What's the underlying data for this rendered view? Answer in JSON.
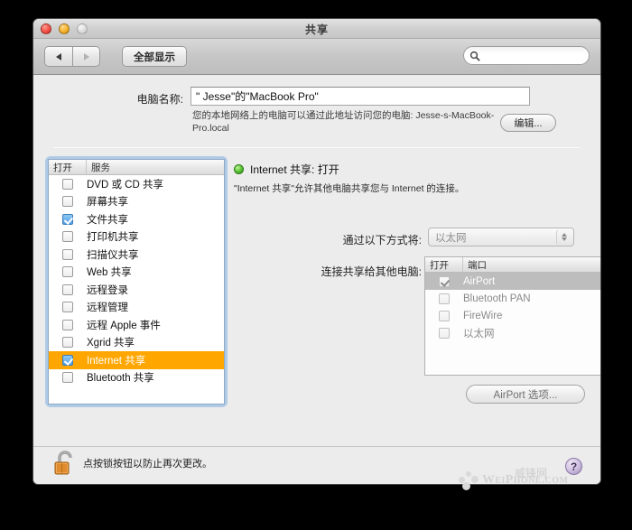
{
  "window": {
    "title": "共享",
    "traffic_lights": {
      "close": "close-button",
      "minimize": "minimize-button",
      "zoom": "zoom-button"
    }
  },
  "toolbar": {
    "back_label": "back",
    "forward_label": "forward",
    "show_all_label": "全部显示",
    "search": {
      "value": "",
      "placeholder": ""
    }
  },
  "computer_name": {
    "label": "电脑名称:",
    "value": "\" Jesse\"的\"MacBook Pro\"",
    "help_text": "您的本地网络上的电脑可以通过此地址访问您的电脑: Jesse-s-MacBook-Pro.local",
    "edit_button": "编辑..."
  },
  "service_list": {
    "columns": [
      "打开",
      "服务"
    ],
    "items": [
      {
        "label": "DVD 或 CD 共享",
        "checked": false,
        "selected": false
      },
      {
        "label": "屏幕共享",
        "checked": false,
        "selected": false
      },
      {
        "label": "文件共享",
        "checked": true,
        "selected": false
      },
      {
        "label": "打印机共享",
        "checked": false,
        "selected": false
      },
      {
        "label": "扫描仪共享",
        "checked": false,
        "selected": false
      },
      {
        "label": "Web 共享",
        "checked": false,
        "selected": false
      },
      {
        "label": "远程登录",
        "checked": false,
        "selected": false
      },
      {
        "label": "远程管理",
        "checked": false,
        "selected": false
      },
      {
        "label": "远程 Apple 事件",
        "checked": false,
        "selected": false
      },
      {
        "label": "Xgrid 共享",
        "checked": false,
        "selected": false
      },
      {
        "label": "Internet 共享",
        "checked": true,
        "selected": true
      },
      {
        "label": "Bluetooth 共享",
        "checked": false,
        "selected": false
      }
    ]
  },
  "detail": {
    "status_title": "Internet 共享: 打开",
    "status_color": "#62c83c",
    "description": "\"Internet 共享\"允许其他电脑共享您与 Internet 的连接。",
    "share_via": {
      "label": "通过以下方式将:",
      "selected": "以太网",
      "disabled": true
    },
    "ports": {
      "label": "连接共享给其他电脑:",
      "columns": [
        "打开",
        "端口"
      ],
      "items": [
        {
          "label": "AirPort",
          "checked": true,
          "selected": true
        },
        {
          "label": "Bluetooth PAN",
          "checked": false,
          "selected": false
        },
        {
          "label": "FireWire",
          "checked": false,
          "selected": false
        },
        {
          "label": "以太网",
          "checked": false,
          "selected": false
        }
      ]
    },
    "options_button": "AirPort 选项..."
  },
  "footer": {
    "lock_text": "点按锁按钮以防止再次更改。",
    "lock_state": "unlocked",
    "help_label": "?"
  },
  "watermark": {
    "text": "WeiPhone.com",
    "cn_text": "威锋网"
  }
}
